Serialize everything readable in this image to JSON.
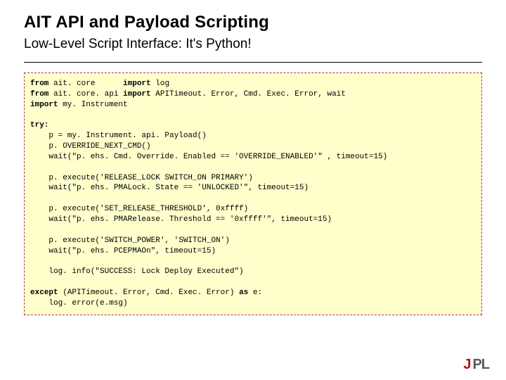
{
  "title": "AIT API and Payload Scripting",
  "subtitle": "Low-Level Script Interface: It's Python!",
  "code_lines": [
    "from ait. core      import log",
    "from ait. core. api import APITimeout. Error, Cmd. Exec. Error, wait",
    "import my. Instrument",
    "",
    "try:",
    "    p = my. Instrument. api. Payload()",
    "    p. OVERRIDE_NEXT_CMD()",
    "    wait(\"p. ehs. Cmd. Override. Enabled == 'OVERRIDE_ENABLED'\" , timeout=15)",
    "",
    "    p. execute('RELEASE_LOCK SWITCH_ON PRIMARY')",
    "    wait(\"p. ehs. PMALock. State == 'UNLOCKED'\", timeout=15)",
    "",
    "    p. execute('SET_RELEASE_THRESHOLD', 0xffff)",
    "    wait(\"p. ehs. PMARelease. Threshold == '0xffff'\", timeout=15)",
    "",
    "    p. execute('SWITCH_POWER', 'SWITCH_ON')",
    "    wait(\"p. ehs. PCEPMAOn\", timeout=15)",
    "",
    "    log. info(\"SUCCESS: Lock Deploy Executed\")",
    "",
    "except (APITimeout. Error, Cmd. Exec. Error) as e:",
    "    log. error(e.msg)",
    ""
  ],
  "logo": {
    "part1": "J",
    "part2": "PL"
  }
}
